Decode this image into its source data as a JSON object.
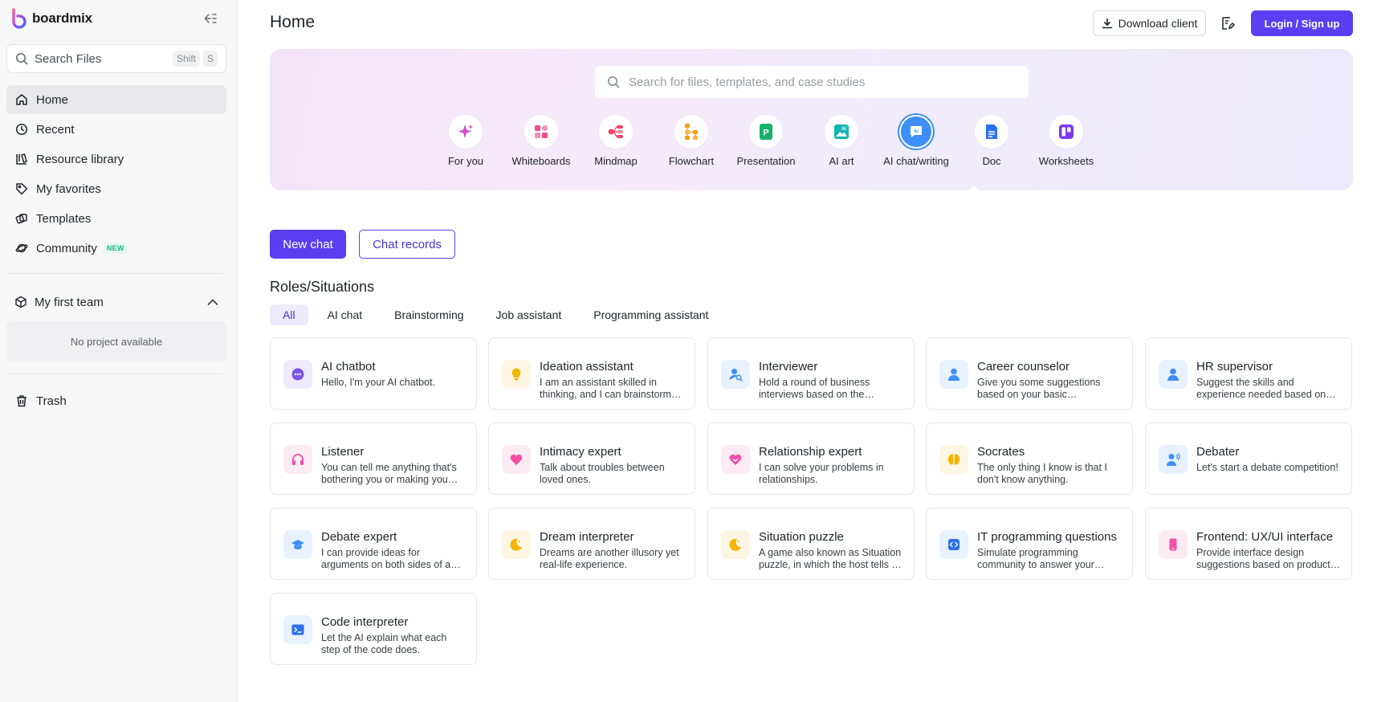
{
  "sidebar": {
    "brand_name": "boardmix",
    "search": {
      "label": "Search Files",
      "shortcut_1": "Shift",
      "shortcut_2": "S"
    },
    "nav": [
      {
        "label": "Home",
        "icon": "home-icon"
      },
      {
        "label": "Recent",
        "icon": "clock-icon"
      },
      {
        "label": "Resource library",
        "icon": "library-icon"
      },
      {
        "label": "My favorites",
        "icon": "tag-icon"
      },
      {
        "label": "Templates",
        "icon": "templates-icon"
      },
      {
        "label": "Community",
        "icon": "planet-icon",
        "badge": "NEW"
      }
    ],
    "team": {
      "label": "My first team",
      "empty_text": "No project available"
    },
    "trash_label": "Trash"
  },
  "header": {
    "title": "Home",
    "download_label": "Download client",
    "login_label": "Login / Sign up"
  },
  "hero": {
    "search_placeholder": "Search for files, templates, and case studies",
    "categories": [
      {
        "label": "For you",
        "icon": "sparkle-icon"
      },
      {
        "label": "Whiteboards",
        "icon": "whiteboard-icon"
      },
      {
        "label": "Mindmap",
        "icon": "mindmap-icon"
      },
      {
        "label": "Flowchart",
        "icon": "flowchart-icon"
      },
      {
        "label": "Presentation",
        "icon": "presentation-icon"
      },
      {
        "label": "AI art",
        "icon": "ai-art-icon"
      },
      {
        "label": "AI chat/writing",
        "icon": "ai-chat-icon",
        "active": true
      },
      {
        "label": "Doc",
        "icon": "doc-icon"
      },
      {
        "label": "Worksheets",
        "icon": "worksheet-icon"
      }
    ]
  },
  "chat": {
    "new_label": "New chat",
    "records_label": "Chat records"
  },
  "roles": {
    "title": "Roles/Situations",
    "filters": [
      "All",
      "AI chat",
      "Brainstorming",
      "Job assistant",
      "Programming assistant"
    ],
    "cards": [
      {
        "title": "AI chatbot",
        "desc": "Hello, I'm your AI chatbot.",
        "icon": "chatbot-icon"
      },
      {
        "title": "Ideation assistant",
        "desc": "I am an assistant skilled in thinking, and I can brainstorm with you.",
        "icon": "lightbulb-icon"
      },
      {
        "title": "Interviewer",
        "desc": "Hold a round of business interviews based on the position.",
        "icon": "interviewer-icon"
      },
      {
        "title": "Career counselor",
        "desc": "Give you some suggestions based on your basic information.",
        "icon": "user-icon"
      },
      {
        "title": "HR supervisor",
        "desc": "Suggest the skills and experience needed based on the position.",
        "icon": "user-icon"
      },
      {
        "title": "Listener",
        "desc": "You can tell me anything that's bothering you or making you happy.",
        "icon": "headphones-icon"
      },
      {
        "title": "Intimacy expert",
        "desc": "Talk about troubles between loved ones.",
        "icon": "heart-icon"
      },
      {
        "title": "Relationship expert",
        "desc": "I can solve your problems in relationships.",
        "icon": "relationship-icon"
      },
      {
        "title": "Socrates",
        "desc": "The only thing I know is that I don't know anything.",
        "icon": "brain-icon"
      },
      {
        "title": "Debater",
        "desc": "Let's start a debate competition!",
        "icon": "speaker-user-icon"
      },
      {
        "title": "Debate expert",
        "desc": "I can provide ideas for arguments on both sides of a debate.",
        "icon": "graduation-cap-icon"
      },
      {
        "title": "Dream interpreter",
        "desc": "Dreams are another illusory yet real-life experience.",
        "icon": "moon-icon"
      },
      {
        "title": "Situation puzzle",
        "desc": "A game also known as Situation puzzle, in which the host tells a story.",
        "icon": "moon-icon"
      },
      {
        "title": "IT programming questions",
        "desc": "Simulate programming community to answer your questions.",
        "icon": "code-icon"
      },
      {
        "title": "Frontend: UX/UI interface",
        "desc": "Provide interface design suggestions based on product needs.",
        "icon": "phone-icon"
      },
      {
        "title": "Code interpreter",
        "desc": "Let the AI explain what each step of the code does.",
        "icon": "terminal-icon"
      }
    ]
  },
  "colors": {
    "accent": "#5b3ef2",
    "active_category": "#3d8ff7"
  }
}
